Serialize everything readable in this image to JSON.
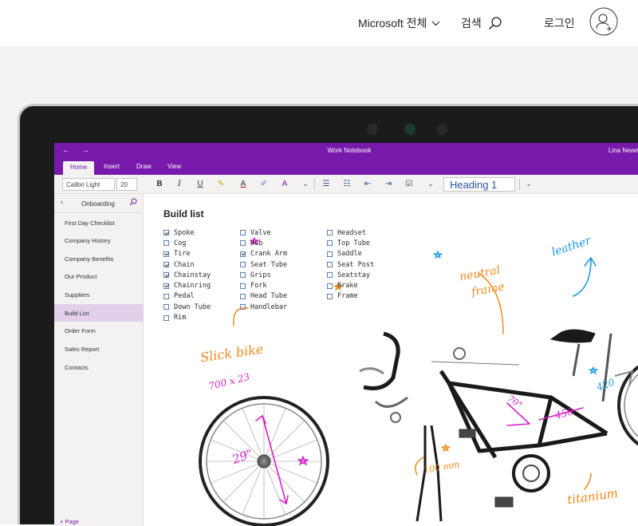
{
  "header": {
    "ms_all": "Microsoft 전체",
    "search": "검색",
    "login": "로그인"
  },
  "onenote": {
    "notebook_title": "Work Notebook",
    "user": "Lina Newm",
    "tabs": [
      "Home",
      "Insert",
      "Draw",
      "View"
    ],
    "font_name": "Calibri Light",
    "font_size": "20",
    "style": "Heading 1",
    "section": "Onboarding",
    "pages": [
      "First Day Checklist",
      "Company History",
      "Company Benefits",
      "Our Product",
      "Suppliers",
      "Build List",
      "Order Form",
      "Sales Report",
      "Contacts"
    ],
    "active_page": "Build List",
    "add_page": "+ Page"
  },
  "note": {
    "title": "Build list",
    "col1": [
      {
        "text": "Spoke",
        "checked": true
      },
      {
        "text": "Cog",
        "checked": false
      },
      {
        "text": "Tire",
        "checked": true
      },
      {
        "text": "Chain",
        "checked": true
      },
      {
        "text": "Chainstay",
        "checked": true
      },
      {
        "text": "Chainring",
        "checked": true
      },
      {
        "text": "Pedal",
        "checked": false
      },
      {
        "text": "Down Tube",
        "checked": false
      },
      {
        "text": "Rim",
        "checked": false
      }
    ],
    "col2": [
      {
        "text": "Valve",
        "checked": false
      },
      {
        "text": "Hub",
        "checked": false
      },
      {
        "text": "Crank Arm",
        "checked": true
      },
      {
        "text": "Seat Tube",
        "checked": false
      },
      {
        "text": "Grips",
        "checked": false
      },
      {
        "text": "Fork",
        "checked": false
      },
      {
        "text": "Head Tube",
        "checked": false
      },
      {
        "text": "Handlebar",
        "checked": false
      }
    ],
    "col3": [
      {
        "text": "Headset",
        "checked": false
      },
      {
        "text": "Top Tube",
        "checked": false
      },
      {
        "text": "Saddle",
        "checked": false
      },
      {
        "text": "Seat Post",
        "checked": false
      },
      {
        "text": "Seatstay",
        "checked": false
      },
      {
        "text": "Brake",
        "checked": false
      },
      {
        "text": "Frame",
        "checked": false
      }
    ]
  },
  "ink": {
    "slick_bike": "Slick bike",
    "tire_size": "700 x 23",
    "wheel": "29\"",
    "neutral": "neutral",
    "frame": "frame",
    "leather": "leather",
    "angle": "70°",
    "tube": "450",
    "seat": "420",
    "crank": "100 mm",
    "titanium": "titanium"
  },
  "colors": {
    "onenote_purple": "#7719aa",
    "ink_magenta": "#d81fc9",
    "ink_orange": "#f08a1c",
    "ink_blue": "#1e9be0"
  }
}
